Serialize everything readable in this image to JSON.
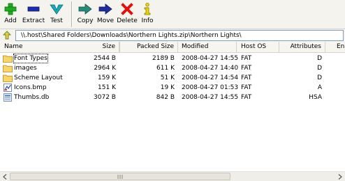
{
  "toolbar": {
    "buttons": [
      {
        "label": "Add",
        "icon": "plus-icon"
      },
      {
        "label": "Extract",
        "icon": "minus-icon"
      },
      {
        "label": "Test",
        "icon": "check-icon"
      },
      {
        "label": "Copy",
        "icon": "copy-arrow-icon"
      },
      {
        "label": "Move",
        "icon": "move-arrow-icon"
      },
      {
        "label": "Delete",
        "icon": "x-icon"
      },
      {
        "label": "Info",
        "icon": "info-icon"
      }
    ]
  },
  "address": {
    "path": "\\\\.host\\Shared Folders\\Downloads\\Northern Lights.zip\\Northern Lights\\"
  },
  "columns": [
    "Name",
    "Size",
    "Packed Size",
    "Modified",
    "Host OS",
    "Attributes",
    "En"
  ],
  "files": [
    {
      "name": "Font Types",
      "size": "2544 B",
      "packed": "2189 B",
      "modified": "2008-04-27 14:55",
      "host": "FAT",
      "attr": "D",
      "type": "folder"
    },
    {
      "name": "images",
      "size": "2964 K",
      "packed": "611 K",
      "modified": "2008-04-27 14:40",
      "host": "FAT",
      "attr": "D",
      "type": "folder"
    },
    {
      "name": "Scheme Layout",
      "size": "159 K",
      "packed": "51 K",
      "modified": "2008-04-27 14:54",
      "host": "FAT",
      "attr": "D",
      "type": "folder"
    },
    {
      "name": "Icons.bmp",
      "size": "151 K",
      "packed": "19 K",
      "modified": "2008-04-27 01:53",
      "host": "FAT",
      "attr": "A",
      "type": "bmp"
    },
    {
      "name": "Thumbs.db",
      "size": "3072 B",
      "packed": "842 B",
      "modified": "2008-04-27 14:55",
      "host": "FAT",
      "attr": "HSA",
      "type": "db"
    }
  ],
  "colors": {
    "toolbar_bg": "#f4f3ee",
    "add_green": "#1faa1f",
    "extract_blue": "#1f2ea8",
    "test_teal": "#19a9b8",
    "delete_red": "#e01010",
    "info_yellow": "#f2d200",
    "folder_yellow": "#f6d56a"
  }
}
